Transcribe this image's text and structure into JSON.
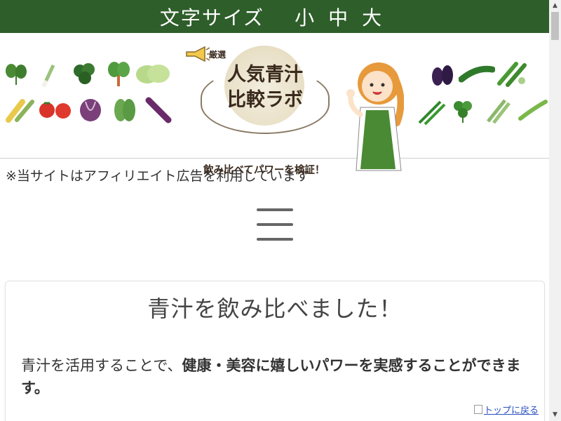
{
  "font_size_bar": {
    "label": "文字サイズ",
    "small": "小",
    "medium": "中",
    "large": "大"
  },
  "header": {
    "logo_selected": "厳選",
    "logo_title_line1": "人気青汁",
    "logo_title_line2": "比較ラボ",
    "logo_subtitle": "飲み比べてパワーを検証！"
  },
  "affiliate_notice": "※当サイトはアフィリエイト広告を利用しています",
  "menu": {
    "icon": "hamburger-menu-icon"
  },
  "article": {
    "heading": "青汁を飲み比べました！",
    "intro_plain": "青汁を活用することで、",
    "intro_bold": "健康・美容に嬉しいパワーを実感することができます。"
  },
  "back_to_top": "トップに戻る",
  "colors": {
    "font_bar_bg": "#2e5e2a",
    "text": "#333333",
    "link": "#2a4fbf"
  }
}
